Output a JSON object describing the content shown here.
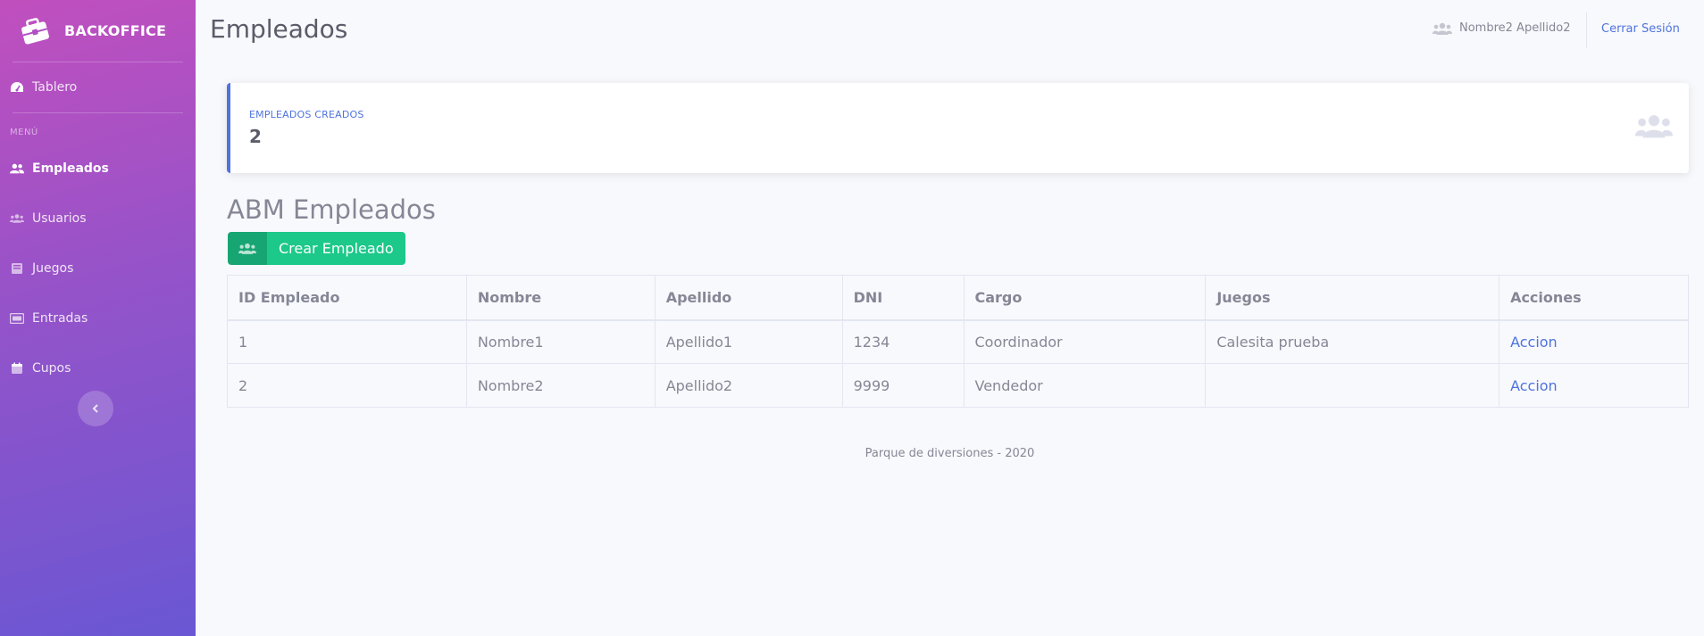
{
  "brand": {
    "name": "BACKOFFICE",
    "icon": "briefcase-icon"
  },
  "sidebar": {
    "dashboard": {
      "label": "Tablero",
      "icon": "tachometer-icon"
    },
    "heading": "MENÚ",
    "items": [
      {
        "label": "Empleados",
        "icon": "users-icon",
        "active": true
      },
      {
        "label": "Usuarios",
        "icon": "users-cog-icon",
        "active": false
      },
      {
        "label": "Juegos",
        "icon": "book-icon",
        "active": false
      },
      {
        "label": "Entradas",
        "icon": "ticket-icon",
        "active": false
      },
      {
        "label": "Cupos",
        "icon": "calendar-icon",
        "active": false
      }
    ],
    "toggle_icon": "chevron-left-icon"
  },
  "topbar": {
    "title": "Empleados",
    "user_name": "Nombre2 Apellido2",
    "logout_label": "Cerrar Sesión"
  },
  "stat_card": {
    "label": "EMPLEADOS CREADOS",
    "value": "2",
    "icon": "users-icon"
  },
  "section": {
    "title": "ABM Empleados",
    "create_button_label": "Crear Empleado"
  },
  "table": {
    "headers": [
      "ID Empleado",
      "Nombre",
      "Apellido",
      "DNI",
      "Cargo",
      "Juegos",
      "Acciones"
    ],
    "rows": [
      [
        "1",
        "Nombre1",
        "Apellido1",
        "1234",
        "Coordinador",
        "Calesita prueba",
        "Accion"
      ],
      [
        "2",
        "Nombre2",
        "Apellido2",
        "9999",
        "Vendedor",
        "",
        "Accion"
      ]
    ]
  },
  "footer": {
    "text": "Parque de diversiones - 2020"
  },
  "colors": {
    "primary": "#4e73df",
    "success": "#1cc88a",
    "success_dark": "#17a673",
    "sidebar_start": "#c14fbe",
    "sidebar_end": "#6a57d3"
  }
}
